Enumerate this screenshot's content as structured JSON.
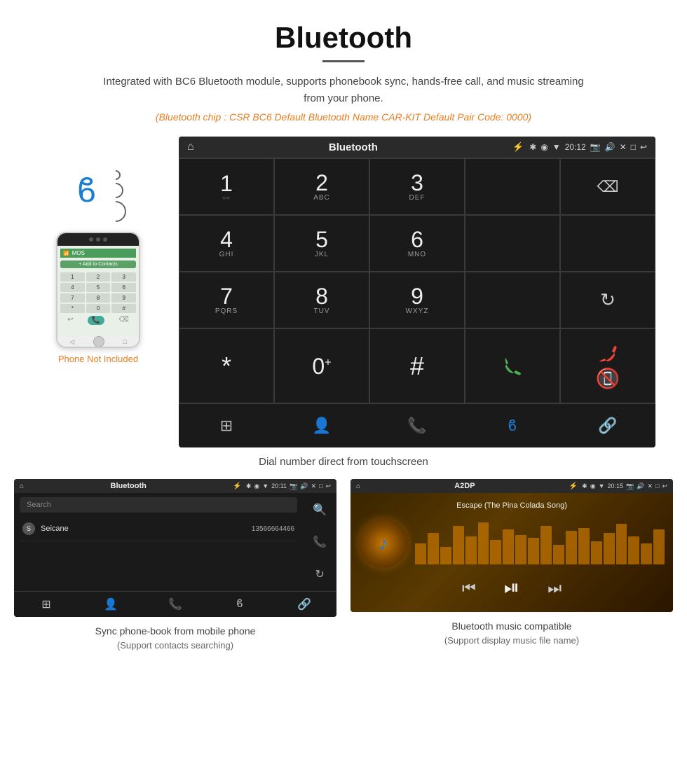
{
  "page": {
    "title": "Bluetooth",
    "subtitle": "Integrated with BC6 Bluetooth module, supports phonebook sync, hands-free call, and music streaming from your phone.",
    "spec_line": "(Bluetooth chip : CSR BC6    Default Bluetooth Name CAR-KIT    Default Pair Code: 0000)",
    "dial_caption": "Dial number direct from touchscreen",
    "phone_not_included": "Phone Not Included"
  },
  "car_screen": {
    "status_title": "Bluetooth",
    "time": "20:12"
  },
  "dialpad": {
    "keys": [
      {
        "num": "1",
        "letters": ""
      },
      {
        "num": "2",
        "letters": "ABC"
      },
      {
        "num": "3",
        "letters": "DEF"
      },
      {
        "num": "4",
        "letters": "GHI"
      },
      {
        "num": "5",
        "letters": "JKL"
      },
      {
        "num": "6",
        "letters": "MNO"
      },
      {
        "num": "7",
        "letters": "PQRS"
      },
      {
        "num": "8",
        "letters": "TUV"
      },
      {
        "num": "9",
        "letters": "WXYZ"
      },
      {
        "num": "*",
        "letters": ""
      },
      {
        "num": "0",
        "letters": "+"
      },
      {
        "num": "#",
        "letters": ""
      }
    ]
  },
  "contacts_screen": {
    "title": "Bluetooth",
    "time": "20:11",
    "search_placeholder": "Search",
    "contacts": [
      {
        "initial": "S",
        "name": "Seicane",
        "number": "13566664466"
      }
    ]
  },
  "music_screen": {
    "title": "A2DP",
    "time": "20:15",
    "song_title": "Escape (The Pina Colada Song)",
    "viz_heights": [
      30,
      45,
      25,
      55,
      40,
      60,
      35,
      50,
      42,
      38,
      55,
      28,
      48,
      52,
      33,
      45,
      58,
      40,
      30,
      50
    ]
  },
  "bottom": {
    "left_caption": "Sync phone-book from mobile phone",
    "left_sub": "(Support contacts searching)",
    "right_caption": "Bluetooth music compatible",
    "right_sub": "(Support display music file name)"
  },
  "icons": {
    "home": "⌂",
    "back": "↩",
    "bluetooth": "✱",
    "bluetooth_unicode": "❋",
    "phone": "📞",
    "person": "👤",
    "grid": "⊞",
    "link": "🔗",
    "search": "🔍",
    "refresh": "↻",
    "backspace": "⌫",
    "call_green": "📞",
    "end_call": "📵",
    "prev": "⏮",
    "play_pause": "⏯",
    "next": "⏭"
  }
}
